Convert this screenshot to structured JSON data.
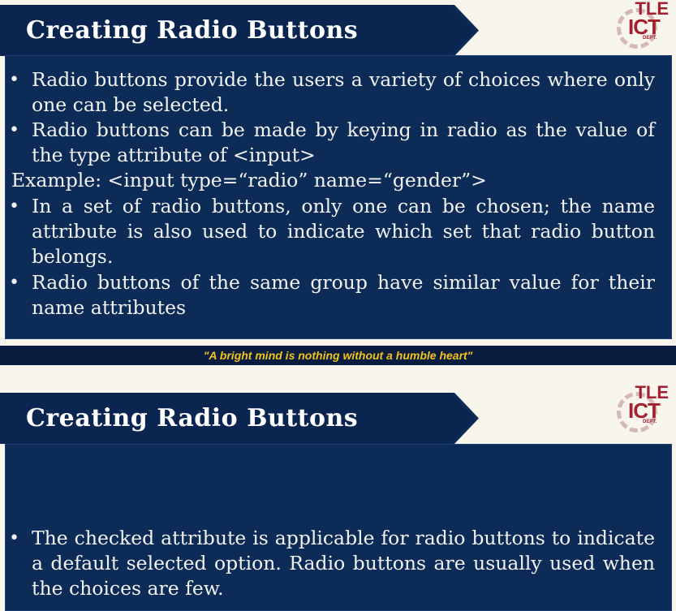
{
  "slide1": {
    "title": "Creating Radio Buttons",
    "logo": {
      "top": "TLE",
      "main": "ICT",
      "sub": "DEPT."
    },
    "bullets": [
      "Radio buttons provide the users a variety of choices where only one can be selected.",
      "Radio buttons can be made by keying in radio as the value of the type attribute of <input>"
    ],
    "example": "Example:  <input type=“radio” name=“gender”>",
    "bullets2": [
      "In a set of radio buttons, only one can be chosen;  the name attribute is also used to indicate which set that radio button belongs.",
      "Radio buttons of the same group have similar value for their name attributes"
    ],
    "bullet_symbol": "•"
  },
  "footer": {
    "quote": "\"A bright mind is nothing without a humble heart\""
  },
  "slide2": {
    "title": "Creating Radio Buttons",
    "logo": {
      "top": "TLE",
      "main": "ICT",
      "sub": "DEPT."
    },
    "bullets": [
      "The checked attribute is applicable for radio buttons to indicate a default selected option.  Radio buttons are usually used when the choices are few."
    ],
    "bullet_symbol": "•"
  },
  "colors": {
    "navy": "#0c2c57",
    "quote": "#f0c419",
    "logo": "#a32030"
  }
}
